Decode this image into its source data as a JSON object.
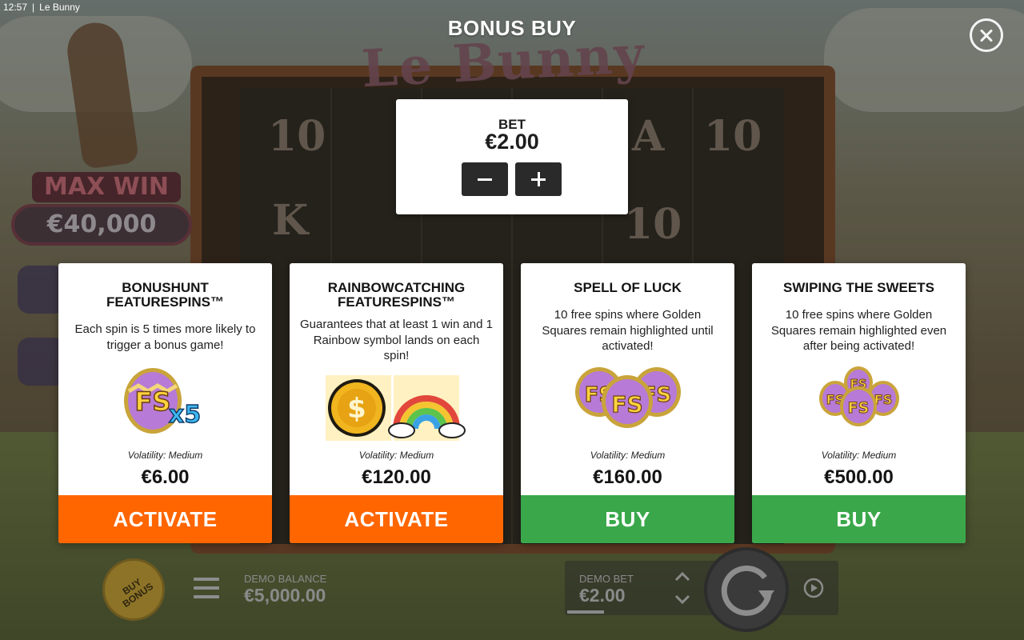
{
  "status": {
    "time": "12:57",
    "app": "Le Bunny"
  },
  "header": {
    "title": "BONUS BUY"
  },
  "background": {
    "logo": "Le Bunny",
    "max_win_label": "MAX WIN",
    "max_win_amount": "€40,000"
  },
  "bet_panel": {
    "label": "BET",
    "value": "€2.00",
    "decrease_icon": "minus-icon",
    "increase_icon": "plus-icon"
  },
  "cards": [
    {
      "title": "BONUSHUNT FEATURESPINS™",
      "description": "Each spin is 5 times more likely to trigger a bonus game!",
      "art": "fs-egg-x5-icon",
      "volatility": "Volatility: Medium",
      "price": "€6.00",
      "action": "ACTIVATE",
      "action_color": "#ff6600"
    },
    {
      "title": "RAINBOWCATCHING FEATURESPINS™",
      "description": "Guarantees that at least 1 win and 1 Rainbow symbol lands on each spin!",
      "art": "coin-and-rainbow-icon",
      "volatility": "Volatility: Medium",
      "price": "€120.00",
      "action": "ACTIVATE",
      "action_color": "#ff6600"
    },
    {
      "title": "SPELL OF LUCK",
      "description": "10 free spins where Golden Squares remain highlighted until activated!",
      "art": "three-fs-eggs-icon",
      "volatility": "Volatility: Medium",
      "price": "€160.00",
      "action": "BUY",
      "action_color": "#3aa84a"
    },
    {
      "title": "SWIPING THE SWEETS",
      "description": "10 free spins where Golden Squares remain highlighted even after being activated!",
      "art": "stacked-fs-eggs-icon",
      "volatility": "Volatility: Medium",
      "price": "€500.00",
      "action": "BUY",
      "action_color": "#3aa84a"
    }
  ],
  "controls": {
    "buy_bonus": "BUY BONUS",
    "balance_label": "DEMO BALANCE",
    "balance_value": "€5,000.00",
    "bet_label": "DEMO BET",
    "bet_value": "€2.00"
  },
  "colors": {
    "activate": "#ff6600",
    "buy": "#3aa84a",
    "card_bg": "#ffffff",
    "overlay": "#000000"
  }
}
